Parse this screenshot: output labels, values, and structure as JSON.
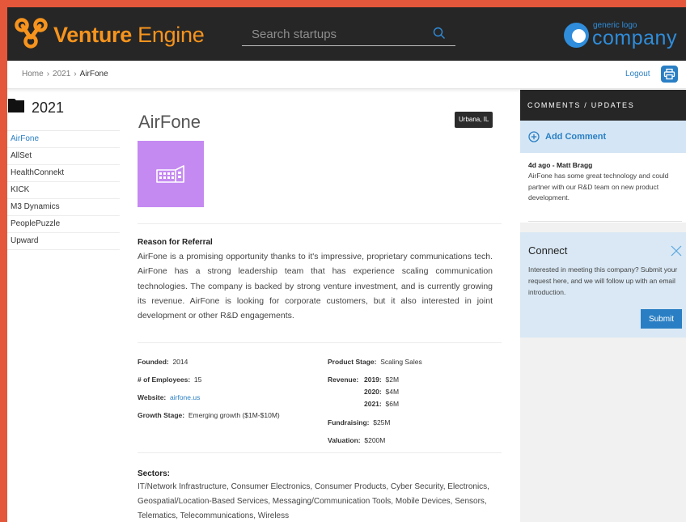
{
  "colors": {
    "accent": "#2a7fc4",
    "brand": "#f7941d",
    "header_bg": "#262626",
    "border": "#e5573a",
    "company_logo_tile": "#c58af1"
  },
  "header": {
    "brand_bold": "Venture",
    "brand_light": " Engine",
    "search_placeholder": "Search startups",
    "partner_logo_small": "generic logo",
    "partner_logo_big": "company"
  },
  "breadcrumb": {
    "items": [
      "Home",
      "2021",
      "AirFone"
    ],
    "logout": "Logout"
  },
  "sidebar": {
    "title": "2021",
    "items": [
      "AirFone",
      "AllSet",
      "HealthConnekt",
      "KICK",
      "M3 Dynamics",
      "PeoplePuzzle",
      "Upward"
    ],
    "active": "AirFone"
  },
  "company": {
    "name": "AirFone",
    "location": "Urbana, IL",
    "reason_heading": "Reason for Referral",
    "reason_text": "AirFone is a promising opportunity thanks to it's impressive, proprietary communications tech. AirFone has a strong leadership team that has experience scaling communication technologies. The company is backed by strong venture investment, and is currently growing its revenue. AirFone is looking for corporate customers, but it also interested in joint development or other R&D engagements.",
    "founded_label": "Founded:",
    "founded": "2014",
    "employees_label": "# of Employees:",
    "employees": "15",
    "website_label": "Website:",
    "website": "airfone.us",
    "growth_label": "Growth Stage:",
    "growth": "Emerging growth ($1M-$10M)",
    "product_stage_label": "Product Stage:",
    "product_stage": "Scaling Sales",
    "revenue_label": "Revenue:",
    "revenue": [
      {
        "year": "2019:",
        "amount": "$2M"
      },
      {
        "year": "2020:",
        "amount": "$4M"
      },
      {
        "year": "2021:",
        "amount": "$6M"
      }
    ],
    "fundraising_label": "Fundraising:",
    "fundraising": "$25M",
    "valuation_label": "Valuation:",
    "valuation": "$200M",
    "sectors_heading": "Sectors:",
    "sectors": "IT/Network Infrastructure, Consumer Electronics, Consumer Products, Cyber Security, Electronics, Geospatial/Location-Based Services, Messaging/Communication Tools, Mobile Devices, Sensors, Telematics, Telecommunications, Wireless"
  },
  "right_panel": {
    "heading": "COMMENTS / UPDATES",
    "add_comment": "Add Comment",
    "comment_meta": "4d ago - Matt Bragg",
    "comment_text": "AirFone has some great technology and could partner with our R&D team on new product development.",
    "connect_heading": "Connect",
    "connect_text": "Interested in meeting this company? Submit your request here, and we will follow up with an email introduction.",
    "submit": "Submit"
  }
}
